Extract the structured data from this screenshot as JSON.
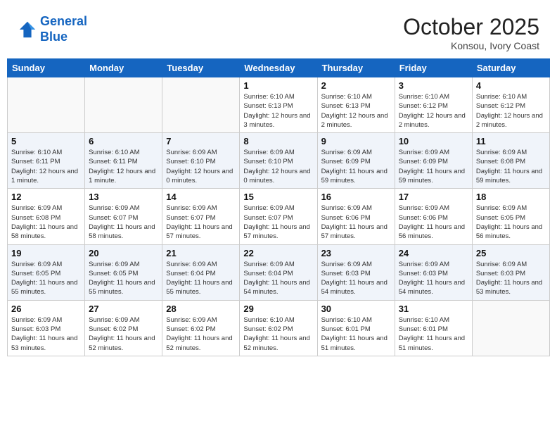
{
  "header": {
    "logo_line1": "General",
    "logo_line2": "Blue",
    "month": "October 2025",
    "location": "Konsou, Ivory Coast"
  },
  "days_of_week": [
    "Sunday",
    "Monday",
    "Tuesday",
    "Wednesday",
    "Thursday",
    "Friday",
    "Saturday"
  ],
  "weeks": [
    [
      {
        "day": "",
        "sunrise": "",
        "sunset": "",
        "daylight": ""
      },
      {
        "day": "",
        "sunrise": "",
        "sunset": "",
        "daylight": ""
      },
      {
        "day": "",
        "sunrise": "",
        "sunset": "",
        "daylight": ""
      },
      {
        "day": "1",
        "sunrise": "Sunrise: 6:10 AM",
        "sunset": "Sunset: 6:13 PM",
        "daylight": "Daylight: 12 hours and 3 minutes."
      },
      {
        "day": "2",
        "sunrise": "Sunrise: 6:10 AM",
        "sunset": "Sunset: 6:13 PM",
        "daylight": "Daylight: 12 hours and 2 minutes."
      },
      {
        "day": "3",
        "sunrise": "Sunrise: 6:10 AM",
        "sunset": "Sunset: 6:12 PM",
        "daylight": "Daylight: 12 hours and 2 minutes."
      },
      {
        "day": "4",
        "sunrise": "Sunrise: 6:10 AM",
        "sunset": "Sunset: 6:12 PM",
        "daylight": "Daylight: 12 hours and 2 minutes."
      }
    ],
    [
      {
        "day": "5",
        "sunrise": "Sunrise: 6:10 AM",
        "sunset": "Sunset: 6:11 PM",
        "daylight": "Daylight: 12 hours and 1 minute."
      },
      {
        "day": "6",
        "sunrise": "Sunrise: 6:10 AM",
        "sunset": "Sunset: 6:11 PM",
        "daylight": "Daylight: 12 hours and 1 minute."
      },
      {
        "day": "7",
        "sunrise": "Sunrise: 6:09 AM",
        "sunset": "Sunset: 6:10 PM",
        "daylight": "Daylight: 12 hours and 0 minutes."
      },
      {
        "day": "8",
        "sunrise": "Sunrise: 6:09 AM",
        "sunset": "Sunset: 6:10 PM",
        "daylight": "Daylight: 12 hours and 0 minutes."
      },
      {
        "day": "9",
        "sunrise": "Sunrise: 6:09 AM",
        "sunset": "Sunset: 6:09 PM",
        "daylight": "Daylight: 11 hours and 59 minutes."
      },
      {
        "day": "10",
        "sunrise": "Sunrise: 6:09 AM",
        "sunset": "Sunset: 6:09 PM",
        "daylight": "Daylight: 11 hours and 59 minutes."
      },
      {
        "day": "11",
        "sunrise": "Sunrise: 6:09 AM",
        "sunset": "Sunset: 6:08 PM",
        "daylight": "Daylight: 11 hours and 59 minutes."
      }
    ],
    [
      {
        "day": "12",
        "sunrise": "Sunrise: 6:09 AM",
        "sunset": "Sunset: 6:08 PM",
        "daylight": "Daylight: 11 hours and 58 minutes."
      },
      {
        "day": "13",
        "sunrise": "Sunrise: 6:09 AM",
        "sunset": "Sunset: 6:07 PM",
        "daylight": "Daylight: 11 hours and 58 minutes."
      },
      {
        "day": "14",
        "sunrise": "Sunrise: 6:09 AM",
        "sunset": "Sunset: 6:07 PM",
        "daylight": "Daylight: 11 hours and 57 minutes."
      },
      {
        "day": "15",
        "sunrise": "Sunrise: 6:09 AM",
        "sunset": "Sunset: 6:07 PM",
        "daylight": "Daylight: 11 hours and 57 minutes."
      },
      {
        "day": "16",
        "sunrise": "Sunrise: 6:09 AM",
        "sunset": "Sunset: 6:06 PM",
        "daylight": "Daylight: 11 hours and 57 minutes."
      },
      {
        "day": "17",
        "sunrise": "Sunrise: 6:09 AM",
        "sunset": "Sunset: 6:06 PM",
        "daylight": "Daylight: 11 hours and 56 minutes."
      },
      {
        "day": "18",
        "sunrise": "Sunrise: 6:09 AM",
        "sunset": "Sunset: 6:05 PM",
        "daylight": "Daylight: 11 hours and 56 minutes."
      }
    ],
    [
      {
        "day": "19",
        "sunrise": "Sunrise: 6:09 AM",
        "sunset": "Sunset: 6:05 PM",
        "daylight": "Daylight: 11 hours and 55 minutes."
      },
      {
        "day": "20",
        "sunrise": "Sunrise: 6:09 AM",
        "sunset": "Sunset: 6:05 PM",
        "daylight": "Daylight: 11 hours and 55 minutes."
      },
      {
        "day": "21",
        "sunrise": "Sunrise: 6:09 AM",
        "sunset": "Sunset: 6:04 PM",
        "daylight": "Daylight: 11 hours and 55 minutes."
      },
      {
        "day": "22",
        "sunrise": "Sunrise: 6:09 AM",
        "sunset": "Sunset: 6:04 PM",
        "daylight": "Daylight: 11 hours and 54 minutes."
      },
      {
        "day": "23",
        "sunrise": "Sunrise: 6:09 AM",
        "sunset": "Sunset: 6:03 PM",
        "daylight": "Daylight: 11 hours and 54 minutes."
      },
      {
        "day": "24",
        "sunrise": "Sunrise: 6:09 AM",
        "sunset": "Sunset: 6:03 PM",
        "daylight": "Daylight: 11 hours and 54 minutes."
      },
      {
        "day": "25",
        "sunrise": "Sunrise: 6:09 AM",
        "sunset": "Sunset: 6:03 PM",
        "daylight": "Daylight: 11 hours and 53 minutes."
      }
    ],
    [
      {
        "day": "26",
        "sunrise": "Sunrise: 6:09 AM",
        "sunset": "Sunset: 6:03 PM",
        "daylight": "Daylight: 11 hours and 53 minutes."
      },
      {
        "day": "27",
        "sunrise": "Sunrise: 6:09 AM",
        "sunset": "Sunset: 6:02 PM",
        "daylight": "Daylight: 11 hours and 52 minutes."
      },
      {
        "day": "28",
        "sunrise": "Sunrise: 6:09 AM",
        "sunset": "Sunset: 6:02 PM",
        "daylight": "Daylight: 11 hours and 52 minutes."
      },
      {
        "day": "29",
        "sunrise": "Sunrise: 6:10 AM",
        "sunset": "Sunset: 6:02 PM",
        "daylight": "Daylight: 11 hours and 52 minutes."
      },
      {
        "day": "30",
        "sunrise": "Sunrise: 6:10 AM",
        "sunset": "Sunset: 6:01 PM",
        "daylight": "Daylight: 11 hours and 51 minutes."
      },
      {
        "day": "31",
        "sunrise": "Sunrise: 6:10 AM",
        "sunset": "Sunset: 6:01 PM",
        "daylight": "Daylight: 11 hours and 51 minutes."
      },
      {
        "day": "",
        "sunrise": "",
        "sunset": "",
        "daylight": ""
      }
    ]
  ]
}
